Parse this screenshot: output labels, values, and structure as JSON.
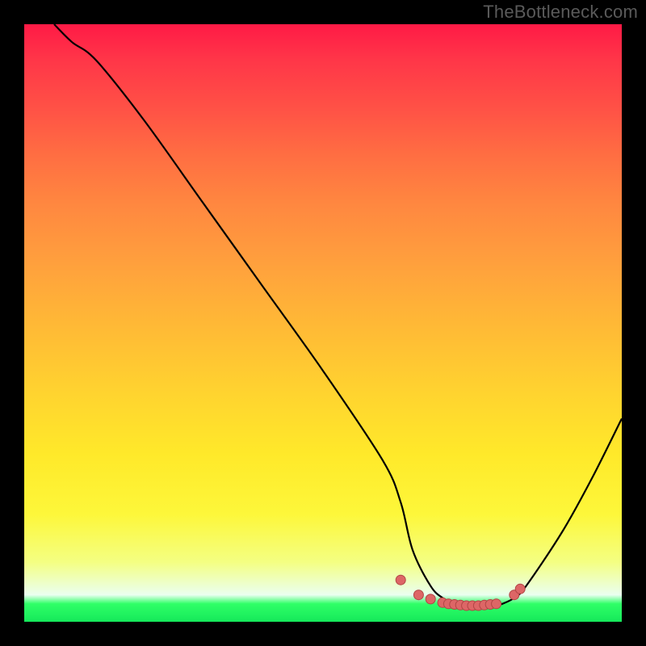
{
  "watermark": "TheBottleneck.com",
  "colors": {
    "frame_bg": "#000000",
    "curve_stroke": "#000000",
    "dot_fill": "#dd6666",
    "dot_stroke": "#b24545",
    "watermark_text": "#5a5a5a"
  },
  "chart_data": {
    "type": "line",
    "title": "",
    "xlabel": "",
    "ylabel": "",
    "xlim": [
      0,
      100
    ],
    "ylim": [
      0,
      100
    ],
    "grid": false,
    "series": [
      {
        "name": "bottleneck-curve",
        "x": [
          5,
          8,
          12,
          20,
          30,
          40,
          50,
          60,
          63,
          65,
          68,
          70,
          72,
          75,
          78,
          80,
          82,
          84,
          90,
          95,
          100
        ],
        "y": [
          100,
          97,
          94,
          84,
          70,
          56,
          42,
          27,
          20,
          12,
          6,
          4,
          3,
          2.5,
          2.5,
          3,
          4,
          6,
          15,
          24,
          34
        ]
      }
    ],
    "dots": {
      "name": "highlight-dots",
      "x": [
        63,
        66,
        68,
        70,
        71,
        72,
        73,
        74,
        75,
        76,
        77,
        78,
        79,
        82,
        83
      ],
      "y": [
        7,
        4.5,
        3.8,
        3.2,
        3.0,
        2.9,
        2.8,
        2.7,
        2.7,
        2.7,
        2.8,
        2.9,
        3.0,
        4.5,
        5.5
      ]
    }
  }
}
